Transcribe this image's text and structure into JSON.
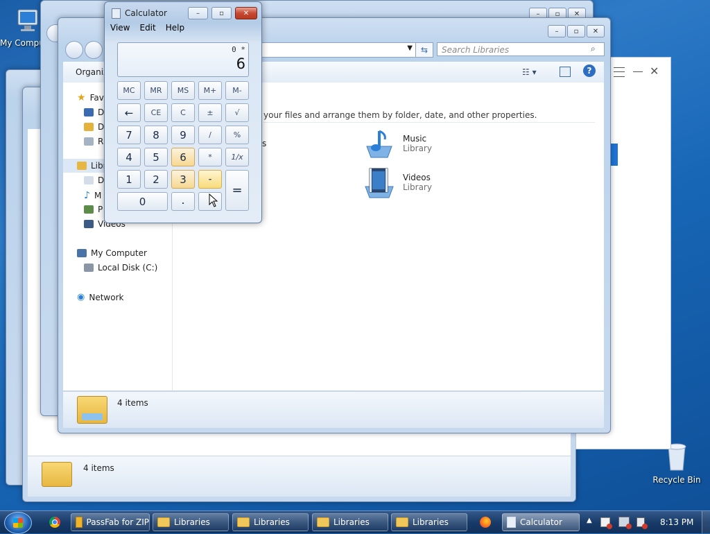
{
  "desktop": {
    "icons": [
      {
        "label": "My Computer"
      },
      {
        "label": "Recycle Bin"
      }
    ]
  },
  "explorer_main": {
    "search_placeholder": "Search Libraries",
    "toolbar": {
      "organize": "Organize"
    },
    "intro_text": "your files and arrange them by folder, date, and other properties.",
    "nav": {
      "favorites": "Fav",
      "fav_items": [
        "D",
        "D",
        "R"
      ],
      "libraries": "Libr",
      "lib_items": [
        "D",
        "M",
        "P",
        "Videos"
      ],
      "computer": "My Computer",
      "computer_items": [
        "Local Disk (C:)"
      ],
      "network": "Network"
    },
    "libraries": [
      {
        "name": "s",
        "sub": ""
      },
      {
        "name": "Music",
        "sub": "Library"
      },
      {
        "name": "Videos",
        "sub": "Library"
      }
    ],
    "status": "4 items"
  },
  "explorer_back": {
    "status": "4 items"
  },
  "calculator": {
    "title": "Calculator",
    "menu": [
      "View",
      "Edit",
      "Help"
    ],
    "display_expr": "0 *",
    "display_value": "6",
    "keys": {
      "memory": [
        "MC",
        "MR",
        "MS",
        "M+",
        "M-"
      ],
      "row2": [
        "←",
        "CE",
        "C",
        "±",
        "√"
      ],
      "row3": [
        "7",
        "8",
        "9",
        "/",
        "%"
      ],
      "row4": [
        "4",
        "5",
        "6",
        "*",
        "1/x"
      ],
      "row5": [
        "1",
        "2",
        "3",
        "-",
        "="
      ],
      "row6": [
        "0",
        "."
      ]
    }
  },
  "taskbar": {
    "items": [
      {
        "label": "PassFab for ZIP"
      },
      {
        "label": "Libraries"
      },
      {
        "label": "Libraries"
      },
      {
        "label": "Libraries"
      },
      {
        "label": "Libraries"
      },
      {
        "label": "Calculator"
      }
    ],
    "clock": "8:13 PM"
  },
  "colors": {
    "accent_highlight": "#f6d893",
    "taskbar": "#193b69",
    "desktop": "#1e6ab8"
  }
}
